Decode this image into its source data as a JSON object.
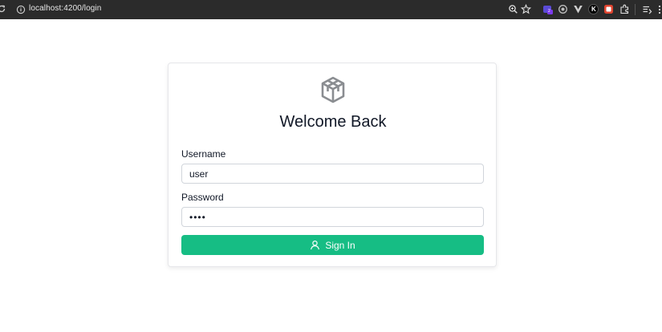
{
  "browser": {
    "url": "localhost:4200/login",
    "extension_badge": "2",
    "extension_k_label": "K",
    "icons": [
      "reload-icon",
      "site-info-icon",
      "zoom-icon",
      "bookmark-star-icon",
      "extension-icon",
      "extension-icon",
      "vue-icon",
      "k-extension-icon",
      "red-extension-icon",
      "puzzle-icon",
      "reading-list-icon"
    ]
  },
  "login": {
    "logo_icon": "cube-logo-icon",
    "title": "Welcome Back",
    "username_label": "Username",
    "username_value": "user",
    "password_label": "Password",
    "password_value": "1234",
    "signin_label": "Sign In",
    "signin_icon": "user-icon"
  },
  "colors": {
    "accent": "#16bd84",
    "browser_bar": "#2b2b2b",
    "title_text": "#111827"
  }
}
